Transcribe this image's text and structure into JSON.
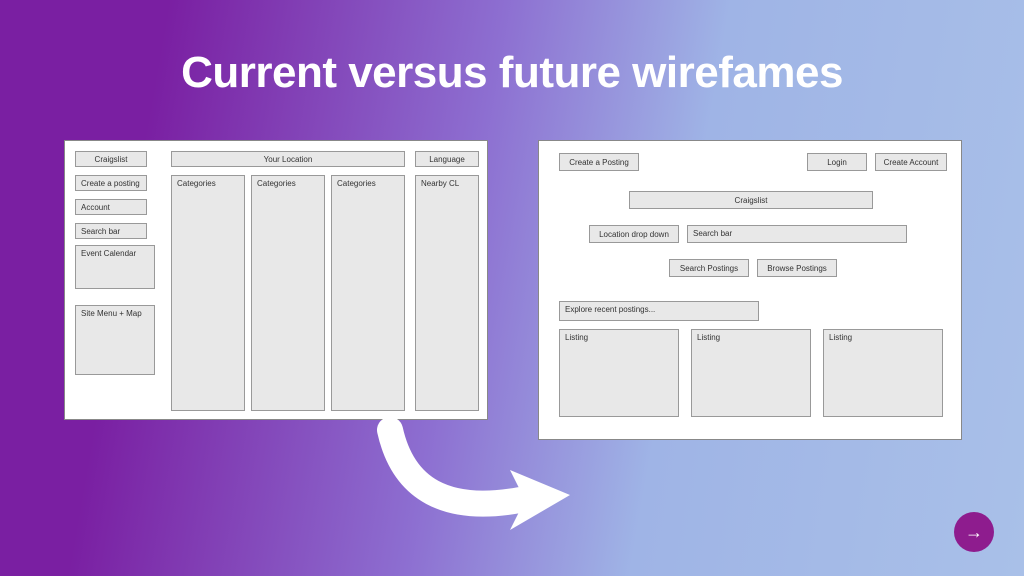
{
  "title": "Current versus future wirefames",
  "left": {
    "craigslist": "Craigslist",
    "your_location": "Your Location",
    "language": "Language",
    "create_posting": "Create a posting",
    "account": "Account",
    "search_bar": "Search bar",
    "event_calendar": "Event Calendar",
    "site_menu_map": "Site Menu + Map",
    "categories1": "Categories",
    "categories2": "Categories",
    "categories3": "Categories",
    "nearby_cl": "Nearby CL"
  },
  "right": {
    "create_posting": "Create a Posting",
    "login": "Login",
    "create_account": "Create Account",
    "craigslist": "Craigslist",
    "location_dd": "Location drop down",
    "search_bar": "Search bar",
    "search_postings": "Search Postings",
    "browse_postings": "Browse Postings",
    "explore": "Explore recent postings...",
    "listing1": "Listing",
    "listing2": "Listing",
    "listing3": "Listing"
  },
  "nav": {
    "next": "→"
  }
}
